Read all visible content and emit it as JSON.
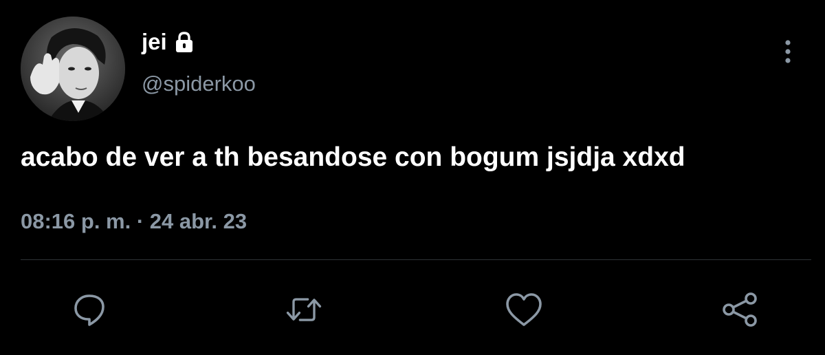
{
  "user": {
    "display_name": "jei",
    "handle": "@spiderkoo",
    "avatar_icon": "avatar-photo",
    "protected_icon": "lock-icon"
  },
  "tweet": {
    "text": "acabo de ver a th besandose con bogum jsjdja xdxd",
    "timestamp": "08:16 p. m. · 24 abr. 23"
  },
  "actions": {
    "reply_icon": "reply-icon",
    "retweet_icon": "retweet-icon",
    "like_icon": "heart-icon",
    "share_icon": "share-icon",
    "more_icon": "more-vertical-icon"
  },
  "colors": {
    "background": "#000000",
    "primary_text": "#ffffff",
    "secondary_text": "#8b98a5",
    "divider": "#2f3336"
  }
}
